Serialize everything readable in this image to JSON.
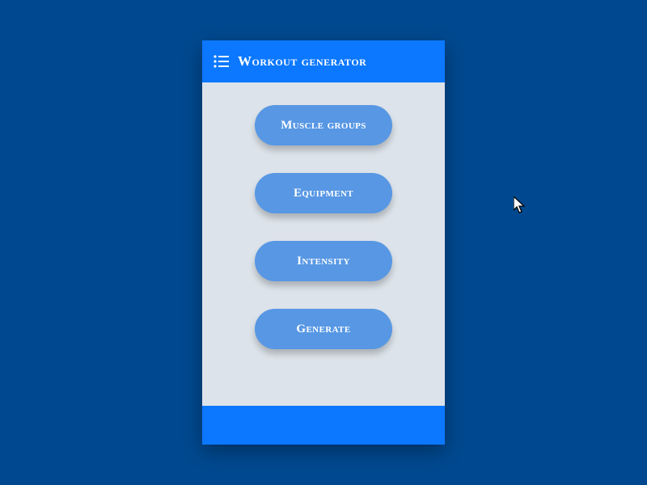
{
  "colors": {
    "page_bg": "#004990",
    "card_bg": "#dce3ea",
    "accent": "#0b78ff",
    "button_bg": "#5797e4",
    "text_on_accent": "#ffffff"
  },
  "header": {
    "icon": "list-icon",
    "title": "Workout generator"
  },
  "buttons": {
    "muscle_groups": "Muscle groups",
    "equipment": "Equipment",
    "intensity": "Intensity",
    "generate": "Generate"
  }
}
